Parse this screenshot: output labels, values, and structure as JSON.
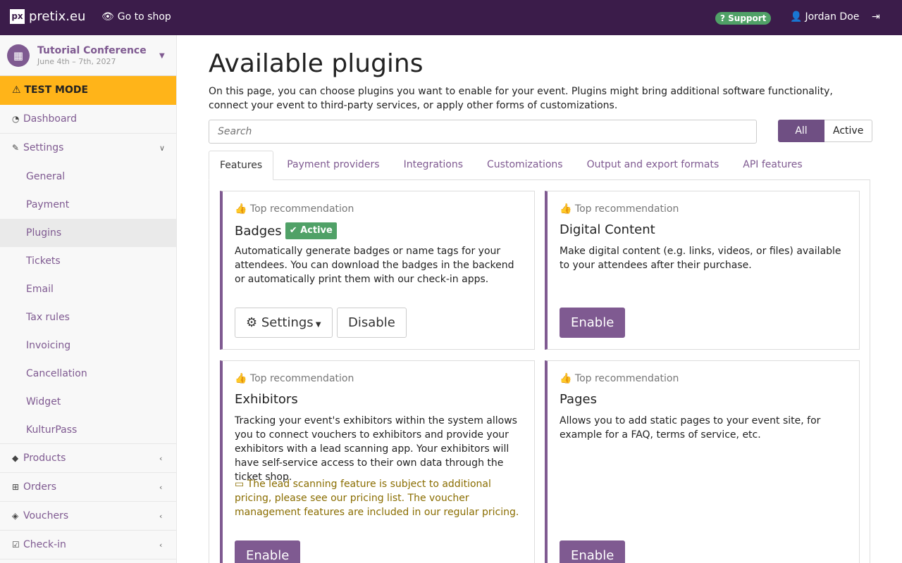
{
  "topbar": {
    "logo_mark": "px",
    "logo_text": "pretix.eu",
    "go_to_shop": "Go to shop",
    "support": "Support",
    "user_name": "Jordan Doe"
  },
  "sidebar": {
    "event_name": "Tutorial Conference",
    "event_dates": "June 4th – 7th, 2027",
    "test_mode": "TEST MODE",
    "dashboard": "Dashboard",
    "settings": "Settings",
    "settings_items": [
      "General",
      "Payment",
      "Plugins",
      "Tickets",
      "Email",
      "Tax rules",
      "Invoicing",
      "Cancellation",
      "Widget",
      "KulturPass"
    ],
    "products": "Products",
    "orders": "Orders",
    "vouchers": "Vouchers",
    "checkin": "Check-in"
  },
  "main": {
    "title": "Available plugins",
    "intro": "On this page, you can choose plugins you want to enable for your event. Plugins might bring additional software functionality, connect your event to third-party services, or apply other forms of customizations.",
    "search_placeholder": "Search",
    "filter_all": "All",
    "filter_active": "Active",
    "tabs": [
      "Features",
      "Payment providers",
      "Integrations",
      "Customizations",
      "Output and export formats",
      "API features"
    ]
  },
  "cards": {
    "rec_label": "Top recommendation",
    "badges": {
      "title": "Badges",
      "status": "Active",
      "desc": "Automatically generate badges or name tags for your attendees. You can download the badges in the backend or automatically print them with our check-in apps.",
      "settings": "Settings",
      "disable": "Disable"
    },
    "digital": {
      "title": "Digital Content",
      "desc": "Make digital content (e.g. links, videos, or files) available to your attendees after their purchase.",
      "enable": "Enable"
    },
    "exhibitors": {
      "title": "Exhibitors",
      "desc": "Tracking your event's exhibitors within the system allows you to connect vouchers to exhibitors and provide your exhibitors with a lead scanning app. Your exhibitors will have self-service access to their own data through the ticket shop.",
      "note": "The lead scanning feature is subject to additional pricing, please see our pricing list. The voucher management features are included in our regular pricing.",
      "enable": "Enable"
    },
    "pages": {
      "title": "Pages",
      "desc": "Allows you to add static pages to your event site, for example for a FAQ, terms of service, etc.",
      "enable": "Enable"
    }
  }
}
